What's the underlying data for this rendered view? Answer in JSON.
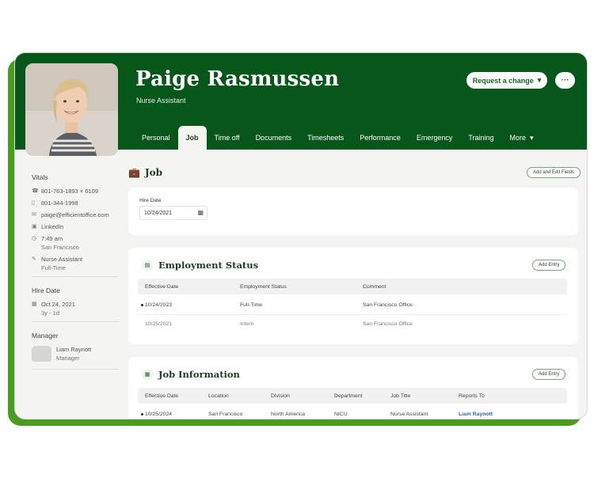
{
  "profile": {
    "name": "Paige Rasmussen",
    "title": "Nurse Assistant",
    "request_label": "Request a change",
    "more_label": "···"
  },
  "tabs": [
    "Personal",
    "Job",
    "Time off",
    "Documents",
    "Timesheets",
    "Performance",
    "Emergency",
    "Training",
    "More"
  ],
  "active_tab": "Job",
  "sidebar": {
    "vitals_heading": "Vitals",
    "phone_work": "801-763-1893 × 6109",
    "phone_mobile": "801-344-1998",
    "email": "paige@efficientoffice.com",
    "linkedin": "LinkedIn",
    "time": "7:49 am",
    "city": "San Francisco",
    "job": "Nurse Assistant",
    "job_type": "Full-Time",
    "hire_heading": "Hire Date",
    "hire_date": "Oct 24, 2021",
    "tenure": "3y - 1d",
    "manager_heading": "Manager",
    "manager_name": "Liam Raynott",
    "manager_role": "Manager"
  },
  "main": {
    "section_title": "Job",
    "add_edit_label": "Add and Edit Fields",
    "hire_label": "Hire Date",
    "hire_value": "10/24/2021"
  },
  "employment": {
    "title": "Employment Status",
    "add_label": "Add Entry",
    "headers": [
      "Effective Date",
      "Employment Status",
      "Comment"
    ],
    "rows": [
      [
        "10/24/2023",
        "Full-Time",
        "San Francisco Office"
      ],
      [
        "10/25/2021",
        "Intern",
        "San Francisco Office"
      ]
    ]
  },
  "job_info": {
    "title": "Job Information",
    "add_label": "Add Entry",
    "headers": [
      "Effective Date",
      "Location",
      "Division",
      "Department",
      "Job Title",
      "Reports To"
    ],
    "rows": [
      [
        "10/25/2024",
        "San Francisco",
        "North America",
        "NICU",
        "Nurse Assistant",
        "Liam Raynott"
      ]
    ]
  },
  "colors": {
    "brand_dark": "#07561a",
    "brand_light": "#4a9c1f",
    "link": "#2b5fb6"
  }
}
